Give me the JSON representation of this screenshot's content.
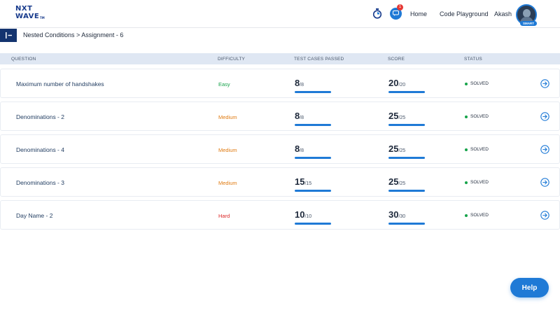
{
  "header": {
    "logo_line1": "NXT",
    "logo_line2": "WAVE",
    "logo_tm": "TM",
    "notification_count": "1",
    "nav_home": "Home",
    "nav_code_playground": "Code Playground",
    "user_name": "Akash",
    "avatar_tag": "SMART"
  },
  "breadcrumb": "Nested Conditions > Assignment - 6",
  "table": {
    "columns": [
      "QUESTION",
      "DIFFICULTY",
      "TEST CASES PASSED",
      "SCORE",
      "STATUS"
    ],
    "rows": [
      {
        "question": "Maximum number of handshakes",
        "difficulty": "Easy",
        "tc_passed": "8",
        "tc_total": "/8",
        "score": "20",
        "score_total": "/20",
        "status": "SOLVED"
      },
      {
        "question": "Denominations - 2",
        "difficulty": "Medium",
        "tc_passed": "8",
        "tc_total": "/8",
        "score": "25",
        "score_total": "/25",
        "status": "SOLVED"
      },
      {
        "question": "Denominations - 4",
        "difficulty": "Medium",
        "tc_passed": "8",
        "tc_total": "/8",
        "score": "25",
        "score_total": "/25",
        "status": "SOLVED"
      },
      {
        "question": "Denominations - 3",
        "difficulty": "Medium",
        "tc_passed": "15",
        "tc_total": "/15",
        "score": "25",
        "score_total": "/25",
        "status": "SOLVED"
      },
      {
        "question": "Day Name - 2",
        "difficulty": "Hard",
        "tc_passed": "10",
        "tc_total": "/10",
        "score": "30",
        "score_total": "/30",
        "status": "SOLVED"
      }
    ]
  },
  "help_label": "Help",
  "colors": {
    "accent": "#1f7ad6",
    "brand": "#183b8c",
    "easy": "#16a34a",
    "medium": "#e07b12",
    "hard": "#dc2626",
    "solved": "#16a34a"
  }
}
